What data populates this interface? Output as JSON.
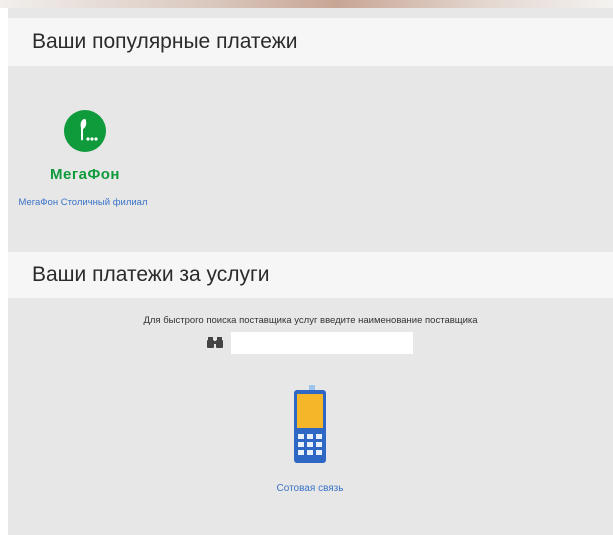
{
  "popular": {
    "heading": "Ваши популярные платежи",
    "items": [
      {
        "brand": "МегаФон",
        "caption": "МегаФон Столичный филиал",
        "icon": "megafon-logo-icon"
      }
    ]
  },
  "services": {
    "heading": "Ваши платежи за услуги",
    "search_hint": "Для быстрого поиска поставщика услуг введите наименование поставщика",
    "search_value": "",
    "search_icon": "binoculars-icon",
    "categories": [
      {
        "label": "Сотовая связь",
        "icon": "mobile-phone-icon"
      }
    ]
  },
  "colors": {
    "megafon_green": "#0f9a3c",
    "link_blue": "#3a73c7",
    "phone_orange": "#f5b62a",
    "phone_blue": "#2f67c4"
  }
}
